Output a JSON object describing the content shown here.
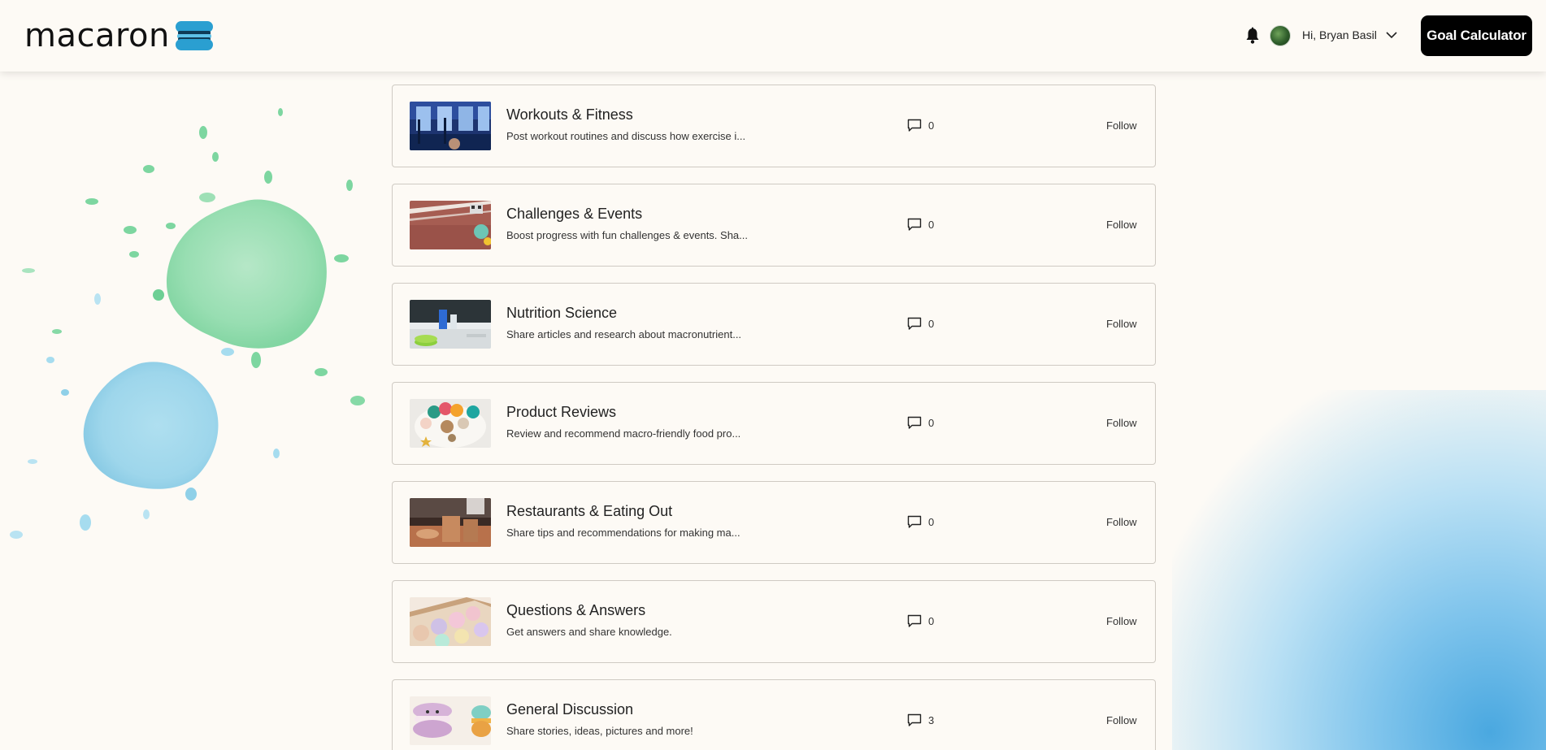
{
  "header": {
    "logo_text": "macaron",
    "logo_icon": "macaron-logo-icon",
    "notifications_icon": "bell-icon",
    "greeting": "Hi, Bryan Basil",
    "menu_icon": "chevron-down-icon",
    "goal_button": "Goal Calculator"
  },
  "colors": {
    "background": "#fdfaf5",
    "logo_blue": "#2a9fd1",
    "button_bg": "#000000",
    "card_border": "#cfcac3",
    "splash_green": "#7dd6a0",
    "splash_blue": "#8fd0e8"
  },
  "forums": [
    {
      "title": "Workouts & Fitness",
      "description": "Post workout routines and discuss how exercise i...",
      "comments": "0",
      "follow": "Follow",
      "thumb": "gym-thumbnail"
    },
    {
      "title": "Challenges & Events",
      "description": "Boost progress with fun challenges & events. Sha...",
      "comments": "0",
      "follow": "Follow",
      "thumb": "running-track-thumbnail"
    },
    {
      "title": "Nutrition Science",
      "description": "Share articles and research about macronutrient...",
      "comments": "0",
      "follow": "Follow",
      "thumb": "lab-thumbnail"
    },
    {
      "title": "Product Reviews",
      "description": "Review and recommend macro-friendly food pro...",
      "comments": "0",
      "follow": "Follow",
      "thumb": "macaron-plate-thumbnail"
    },
    {
      "title": "Restaurants & Eating Out",
      "description": "Share tips and recommendations for making ma...",
      "comments": "0",
      "follow": "Follow",
      "thumb": "takeout-bags-thumbnail"
    },
    {
      "title": "Questions & Answers",
      "description": "Get answers and share knowledge.",
      "comments": "0",
      "follow": "Follow",
      "thumb": "question-macarons-thumbnail"
    },
    {
      "title": "General Discussion",
      "description": "Share stories, ideas, pictures and more!",
      "comments": "3",
      "follow": "Follow",
      "thumb": "macaron-characters-thumbnail"
    }
  ]
}
